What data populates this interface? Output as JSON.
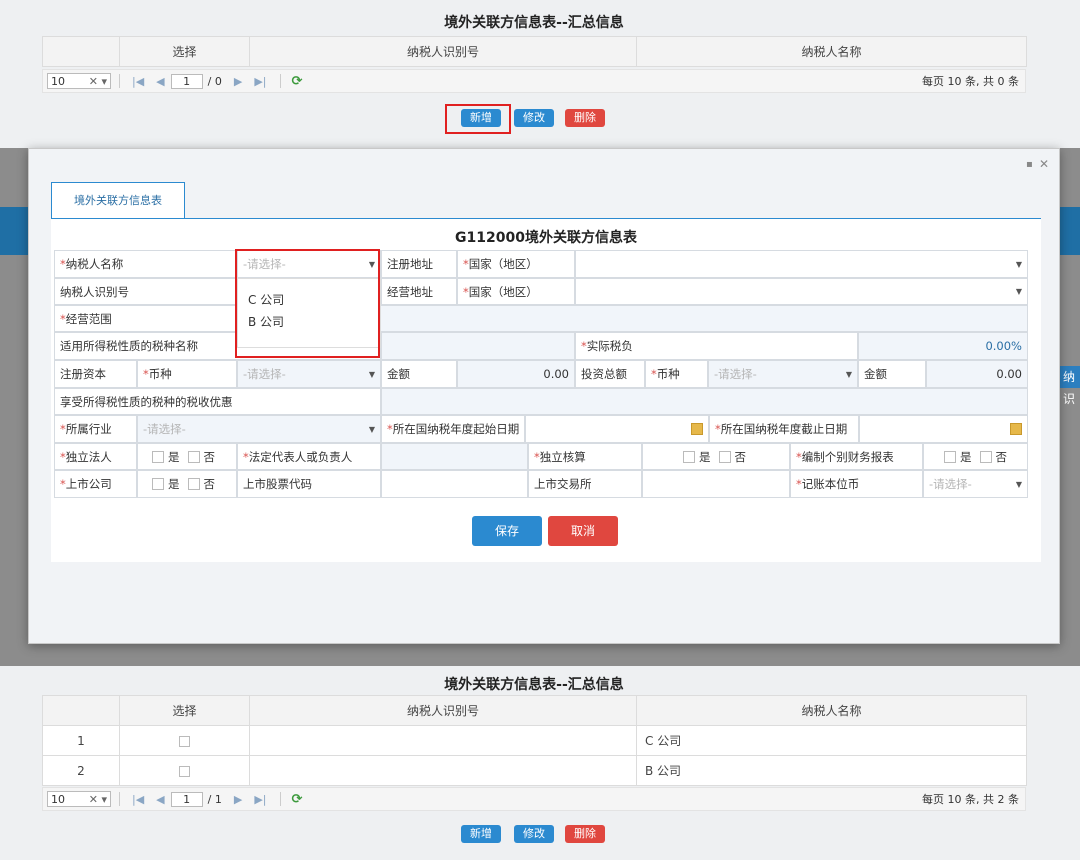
{
  "summary_top": {
    "title": "境外关联方信息表--汇总信息",
    "columns": [
      "",
      "选择",
      "纳税人识别号",
      "纳税人名称"
    ],
    "pager": {
      "page_size": "10",
      "page": "1",
      "total_pages": "/ 0",
      "info": "每页 10 条, 共 0 条"
    },
    "buttons": {
      "add": "新增",
      "edit": "修改",
      "delete": "删除"
    }
  },
  "dialog": {
    "tab_label": "境外关联方信息表",
    "form_title": "G112000境外关联方信息表",
    "placeholder_select": "-请选择-",
    "fields": {
      "taxpayer_name": "纳税人名称",
      "taxpayer_id": "纳税人识别号",
      "business_scope": "经营范围",
      "reg_address": "注册地址",
      "business_address": "经营地址",
      "country": "国家（地区）",
      "applicable_tax": "适用所得税性质的税种名称",
      "actual_tax_burden": "实际税负",
      "actual_tax_value": "0.00%",
      "reg_capital": "注册资本",
      "currency": "币种",
      "amount": "金额",
      "amount_value_1": "0.00",
      "total_investment": "投资总额",
      "amount_value_2": "0.00",
      "tax_incentive": "享受所得税性质的税种的税收优惠",
      "industry": "所属行业",
      "tax_year_start": "所在国纳税年度起始日期",
      "tax_year_end": "所在国纳税年度截止日期",
      "independent_legal": "独立法人",
      "legal_rep": "法定代表人或负责人",
      "independent_accounting": "独立核算",
      "separate_reports": "编制个别财务报表",
      "listed_company": "上市公司",
      "stock_code": "上市股票代码",
      "stock_exchange": "上市交易所",
      "bookkeeping_currency": "记账本位币",
      "yes": "是",
      "no": "否"
    },
    "dropdown_options": [
      "C 公司",
      "B 公司"
    ],
    "save": "保存",
    "cancel": "取消"
  },
  "summary_bottom": {
    "title": "境外关联方信息表--汇总信息",
    "columns": [
      "",
      "选择",
      "纳税人识别号",
      "纳税人名称"
    ],
    "rows": [
      {
        "num": "1",
        "taxpayer_id": "",
        "name": "C 公司"
      },
      {
        "num": "2",
        "taxpayer_id": "",
        "name": "B 公司"
      }
    ],
    "pager": {
      "page_size": "10",
      "page": "1",
      "total_pages": "/ 1",
      "info": "每页 10 条, 共 2 条"
    },
    "buttons": {
      "add": "新增",
      "edit": "修改",
      "delete": "删除"
    }
  },
  "side_tab_text": "纳识",
  "colors": {
    "primary_blue": "#2b8ad0",
    "danger_red": "#e0473f",
    "highlight_red": "#e02020"
  }
}
